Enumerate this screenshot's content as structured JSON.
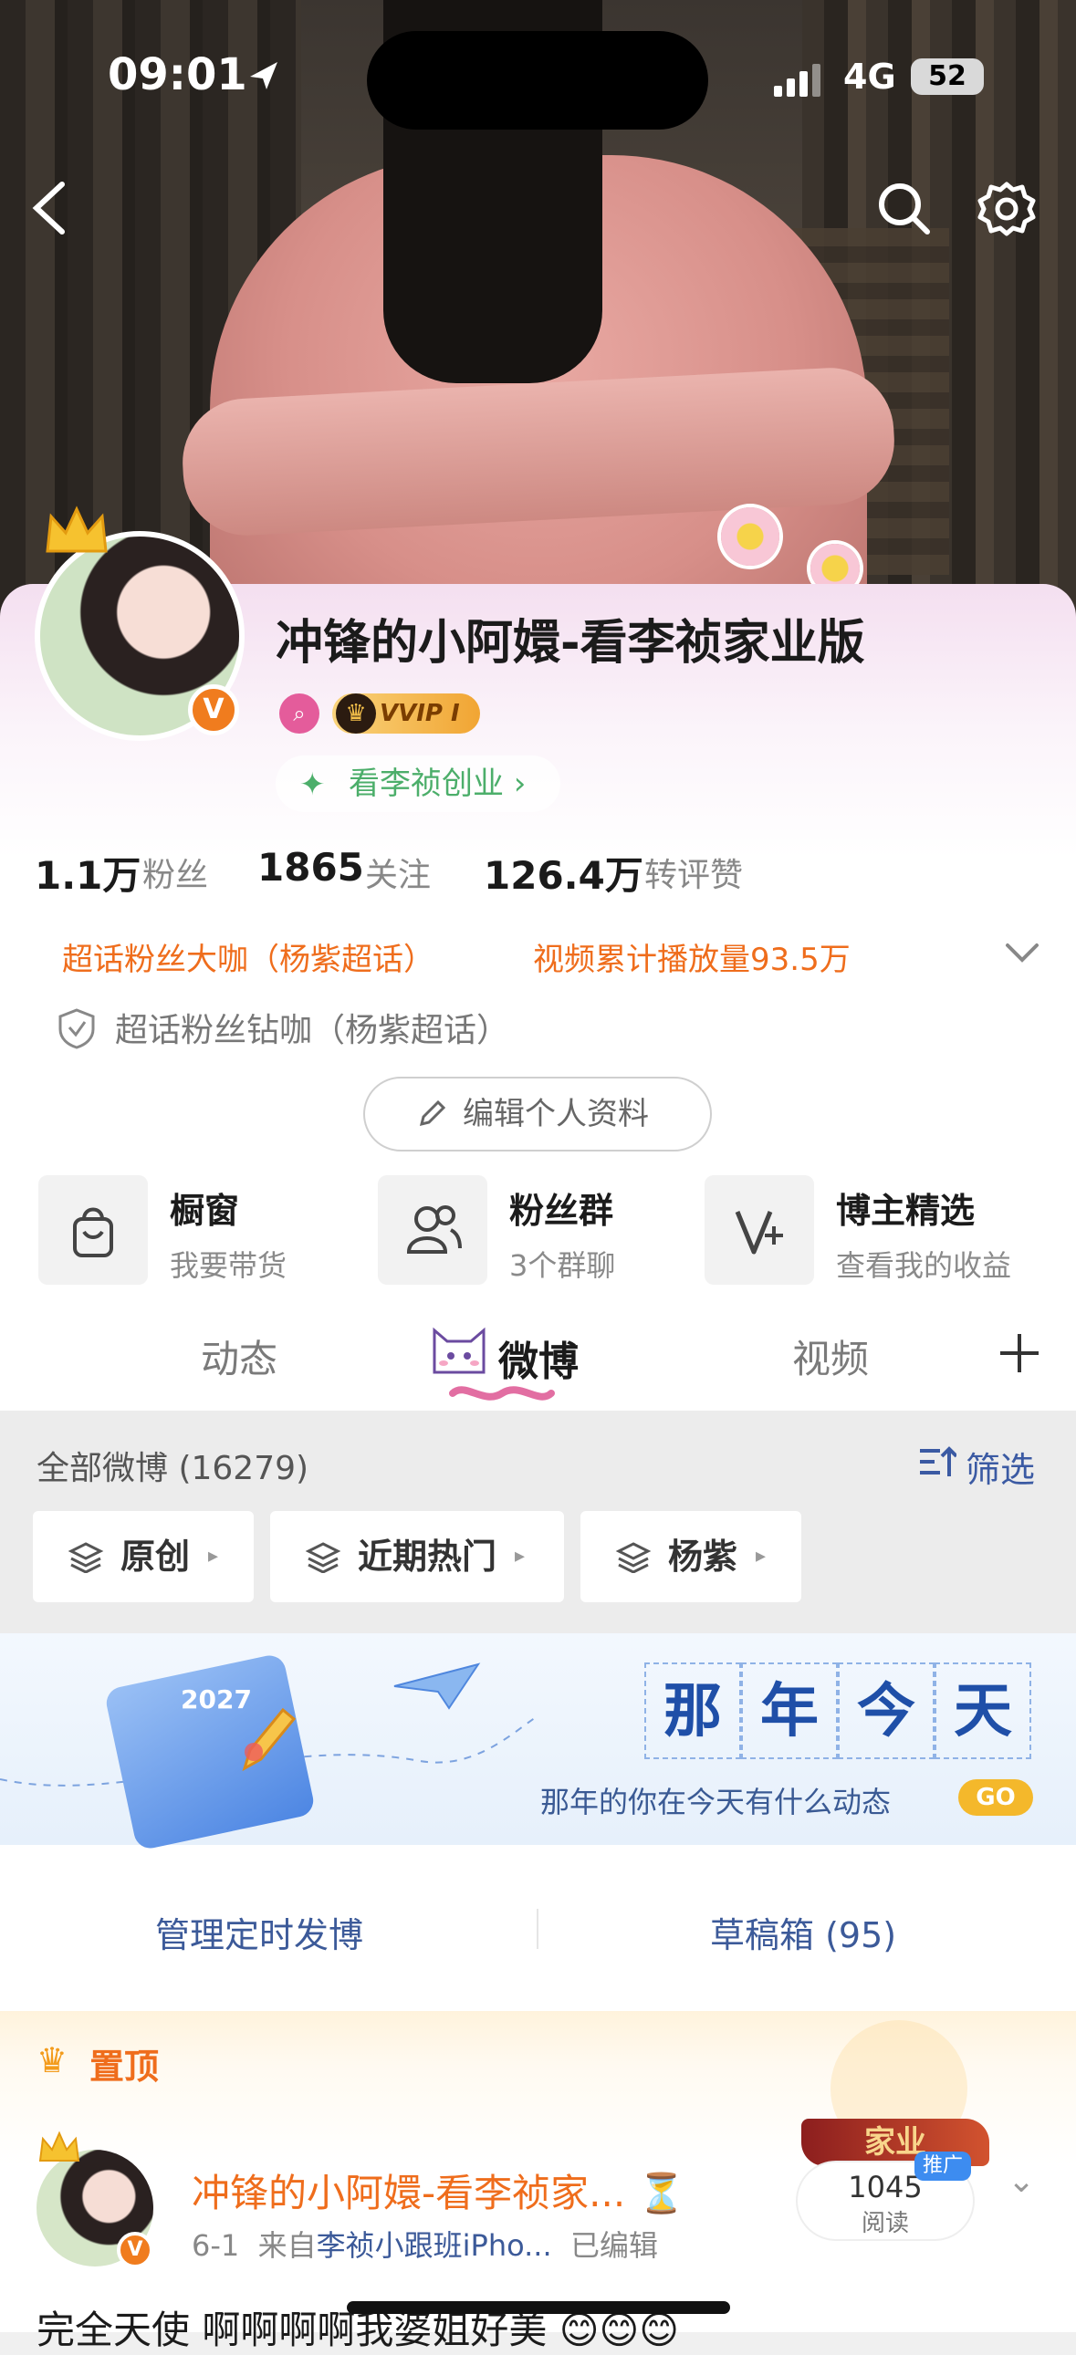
{
  "status_bar": {
    "time": "09:01",
    "network": "4G",
    "battery": "52"
  },
  "header": {
    "name": "冲锋的小阿嬛-看李祯家业版",
    "vip_label": "VVIP I",
    "startup_chip": "看李祯创业 ›"
  },
  "stats": [
    {
      "value": "1.1万",
      "label": "粉丝"
    },
    {
      "value": "1865",
      "label": "关注"
    },
    {
      "value": "126.4万",
      "label": "转评赞"
    }
  ],
  "honors": {
    "left": "超话粉丝大咖（杨紫超话）",
    "right": "视频累计播放量93.5万",
    "diamond": "超话粉丝钻咖（杨紫超话）"
  },
  "edit_button": "编辑个人资料",
  "features": [
    {
      "title": "橱窗",
      "subtitle": "我要带货",
      "icon": "bag-icon"
    },
    {
      "title": "粉丝群",
      "subtitle": "3个群聊",
      "icon": "group-icon"
    },
    {
      "title": "博主精选",
      "subtitle": "查看我的收益",
      "icon": "v-plus-icon"
    }
  ],
  "tabs": [
    "动态",
    "微博",
    "视频"
  ],
  "feed": {
    "all_label": "全部微博 (16279)",
    "filter_label": "筛选",
    "pills": [
      "原创",
      "近期热门",
      "杨紫"
    ]
  },
  "banner": {
    "chars": [
      "那",
      "年",
      "今",
      "天"
    ],
    "subtitle": "那年的你在今天有什么动态",
    "go": "GO",
    "calendar_year": "2027"
  },
  "manage": {
    "left": "管理定时发博",
    "right": "草稿箱 (95)"
  },
  "post": {
    "pin": "置顶",
    "name": "冲锋的小阿嬛-看李祯家... ⏳",
    "date": "6-1",
    "from": "来自",
    "source": "李祯小跟班iPho...",
    "edited": "已编辑",
    "read_count": "1045",
    "read_label": "阅读",
    "family_badge": "家业",
    "promo": "推广",
    "text": "完全天使 啊啊啊啊我婆姐好美 😊😊😊"
  },
  "colors": {
    "accent_orange": "#ef6d1c",
    "link_blue": "#3c5a99",
    "vip_gold": "#f1a533"
  }
}
